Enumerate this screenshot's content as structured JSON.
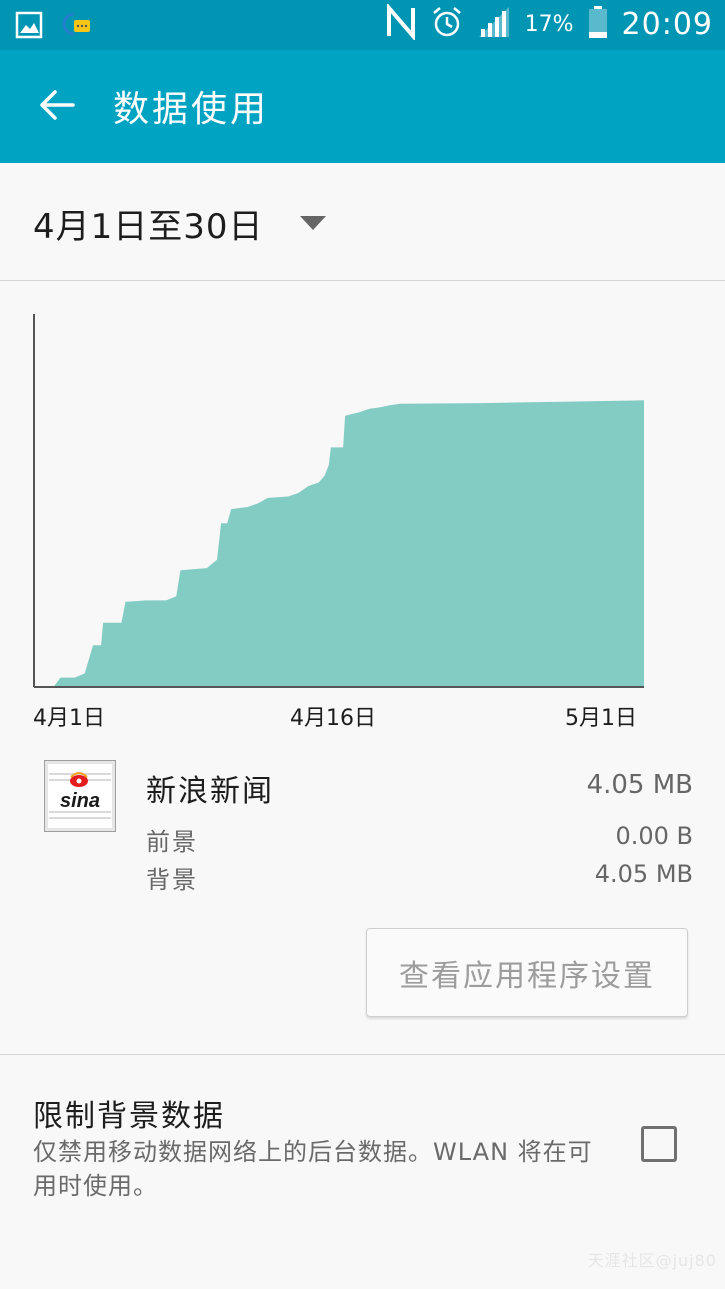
{
  "status_bar": {
    "battery": "17%",
    "time": "20:09",
    "icons": [
      "gallery-icon",
      "chat-notification-icon",
      "nfc-icon",
      "alarm-icon",
      "signal-icon",
      "battery-icon"
    ]
  },
  "app_bar": {
    "title": "数据使用",
    "back_icon": "back-arrow-icon",
    "color": "#00a3c2"
  },
  "period": {
    "label": "4月1日至30日",
    "dropdown_icon": "caret-down-icon"
  },
  "chart_data": {
    "type": "area",
    "x_tick_labels": [
      "4月1日",
      "4月16日",
      "5月1日"
    ],
    "x_range_days": [
      0,
      30
    ],
    "fill_color": "#83ccc4",
    "points": [
      [
        0,
        0.0
      ],
      [
        1.0,
        0.0
      ],
      [
        1.3,
        0.12
      ],
      [
        2.0,
        0.12
      ],
      [
        2.5,
        0.18
      ],
      [
        2.9,
        0.58
      ],
      [
        3.3,
        0.58
      ],
      [
        3.4,
        0.9
      ],
      [
        4.3,
        0.9
      ],
      [
        4.5,
        1.2
      ],
      [
        5.5,
        1.22
      ],
      [
        6.5,
        1.22
      ],
      [
        7.0,
        1.28
      ],
      [
        7.2,
        1.65
      ],
      [
        8.5,
        1.68
      ],
      [
        9.0,
        1.8
      ],
      [
        9.2,
        2.32
      ],
      [
        9.5,
        2.32
      ],
      [
        9.7,
        2.52
      ],
      [
        10.5,
        2.55
      ],
      [
        11.0,
        2.6
      ],
      [
        11.5,
        2.68
      ],
      [
        12.5,
        2.7
      ],
      [
        13.0,
        2.75
      ],
      [
        13.5,
        2.85
      ],
      [
        14.0,
        2.9
      ],
      [
        14.3,
        3.0
      ],
      [
        14.5,
        3.15
      ],
      [
        14.6,
        3.4
      ],
      [
        15.2,
        3.4
      ],
      [
        15.3,
        3.85
      ],
      [
        16.0,
        3.9
      ],
      [
        16.5,
        3.95
      ],
      [
        17.0,
        3.97
      ],
      [
        17.5,
        4.0
      ],
      [
        18.0,
        4.02
      ],
      [
        22.0,
        4.03
      ],
      [
        24.0,
        4.04
      ],
      [
        26.0,
        4.05
      ],
      [
        28.0,
        4.06
      ],
      [
        30.0,
        4.07
      ]
    ],
    "y_max": 5.3
  },
  "app_usage": {
    "name": "新浪新闻",
    "icon": "sina-logo-icon",
    "icon_text": "sina",
    "total": "4.05 MB",
    "foreground_label": "前景",
    "foreground_value": "0.00 B",
    "background_label": "背景",
    "background_value": "4.05 MB"
  },
  "app_settings_button": "查看应用程序设置",
  "restrict_background": {
    "title": "限制背景数据",
    "description": "仅禁用移动数据网络上的后台数据。WLAN 将在可用时使用。",
    "checked": false
  },
  "watermark": "天涯社区@juj80"
}
